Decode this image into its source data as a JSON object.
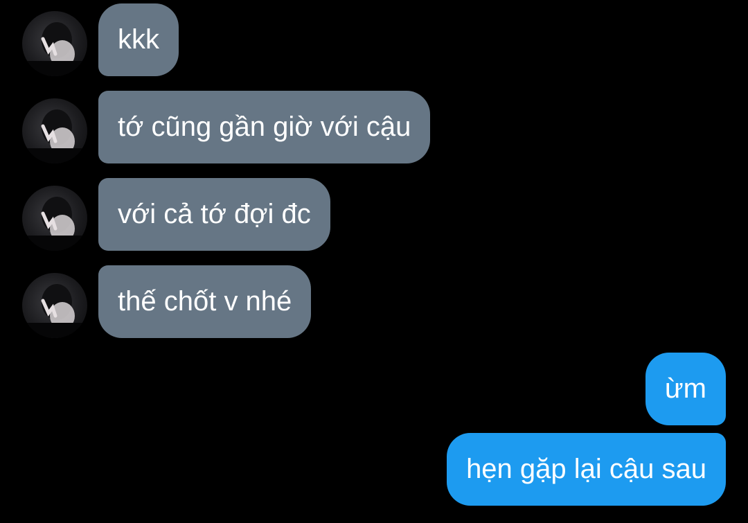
{
  "conversation": {
    "incoming": [
      {
        "text": "kkk",
        "avatar_icon": "contact-avatar"
      },
      {
        "text": "tớ cũng gần giờ với cậu",
        "avatar_icon": "contact-avatar"
      },
      {
        "text": "với cả tớ đợi đc",
        "avatar_icon": "contact-avatar"
      },
      {
        "text": "thế chốt v nhé",
        "avatar_icon": "contact-avatar"
      }
    ],
    "outgoing": [
      {
        "text": "ừm"
      },
      {
        "text": "hẹn gặp lại cậu sau"
      }
    ]
  },
  "colors": {
    "background": "#000000",
    "incoming_bubble": "#667685",
    "outgoing_bubble": "#1d9bf0",
    "text": "#ffffff"
  }
}
